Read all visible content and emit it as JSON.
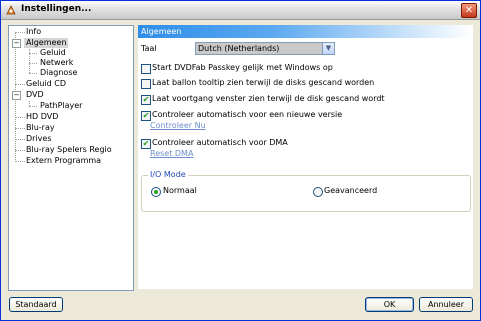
{
  "window": {
    "title": "Instellingen..."
  },
  "sidebar": {
    "items": [
      {
        "label": "Info"
      },
      {
        "label": "Algemeen"
      },
      {
        "label": "Geluid"
      },
      {
        "label": "Netwerk"
      },
      {
        "label": "Diagnose"
      },
      {
        "label": "Geluid CD"
      },
      {
        "label": "DVD"
      },
      {
        "label": "PathPlayer"
      },
      {
        "label": "HD DVD"
      },
      {
        "label": "Blu-ray"
      },
      {
        "label": "Drives"
      },
      {
        "label": "Blu-ray Spelers Regio"
      },
      {
        "label": "Extern Programma"
      }
    ]
  },
  "panel": {
    "header": "Algemeen",
    "language_label": "Taal",
    "language_value": "Dutch (Netherlands)",
    "options": [
      {
        "label": "Start DVDFab Passkey gelijk met Windows op",
        "checked": false
      },
      {
        "label": "Laat ballon tooltip zien terwijl de disks gescand worden",
        "checked": false
      },
      {
        "label": "Laat voortgang venster zien terwijl de disk gescand wordt",
        "checked": true
      },
      {
        "label": "Controleer automatisch voor een nieuwe versie",
        "checked": true
      },
      {
        "label": "Controleer automatisch voor DMA",
        "checked": true
      }
    ],
    "check_now_link": "Controleer Nu",
    "reset_dma_link": "Reset DMA",
    "io_mode": {
      "title": "I/O Mode",
      "normal_label": "Normaal",
      "advanced_label": "Geavanceerd",
      "selected": "Normaal"
    }
  },
  "buttons": {
    "standard": "Standaard",
    "ok": "OK",
    "cancel": "Annuleer"
  }
}
